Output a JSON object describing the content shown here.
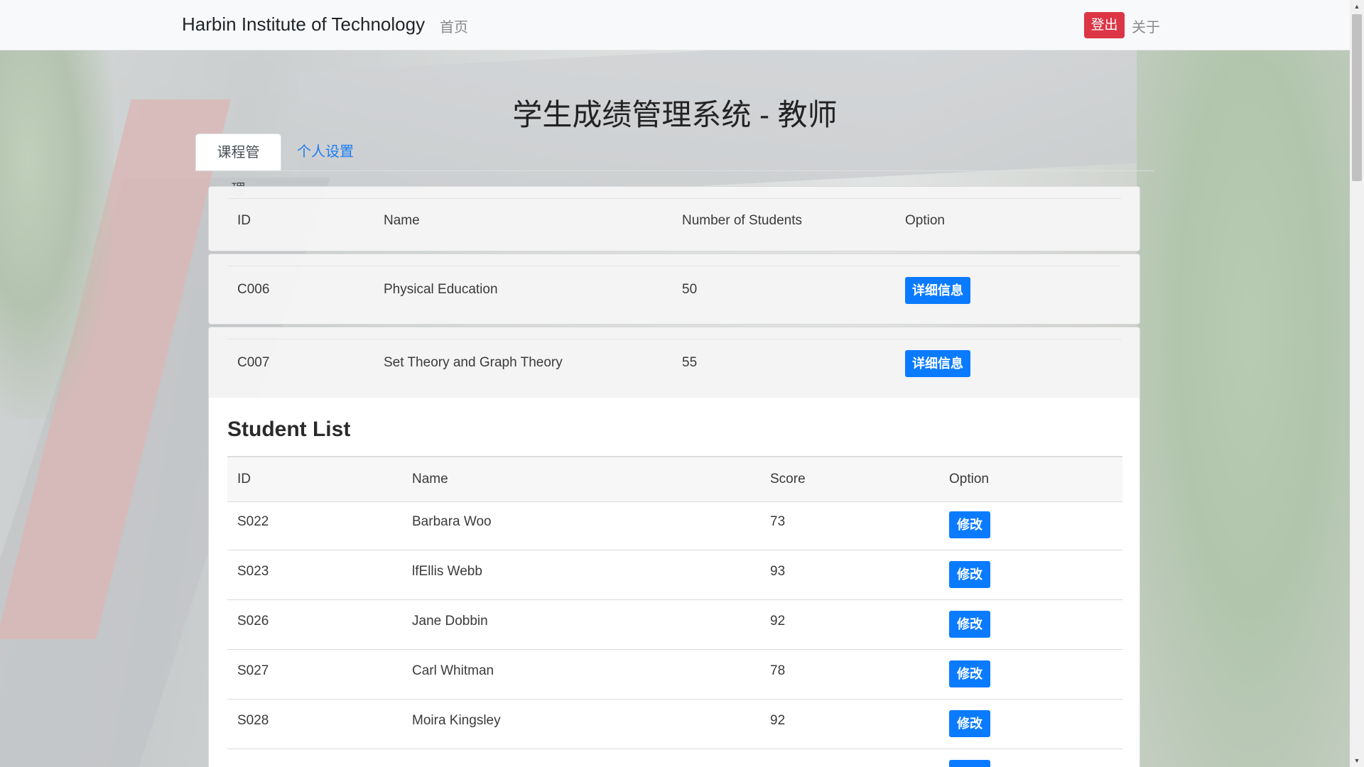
{
  "navbar": {
    "brand": "Harbin Institute of Technology",
    "home": "首页",
    "logout": "登出",
    "about": "关于"
  },
  "page_title": "学生成绩管理系统 - 教师",
  "tabs": [
    {
      "label": "课程管理",
      "active": true
    },
    {
      "label": "个人设置",
      "active": false
    }
  ],
  "courses": {
    "headers": [
      "ID",
      "Name",
      "Number of Students",
      "Option"
    ],
    "rows": [
      {
        "id": "C006",
        "name": "Physical Education",
        "students": "50",
        "action": "详细信息"
      },
      {
        "id": "C007",
        "name": "Set Theory and Graph Theory",
        "students": "55",
        "action": "详细信息"
      }
    ]
  },
  "student_list": {
    "title": "Student List",
    "headers": [
      "ID",
      "Name",
      "Score",
      "Option"
    ],
    "rows": [
      {
        "id": "S022",
        "name": "Barbara Woo",
        "score": "73",
        "action": "修改"
      },
      {
        "id": "S023",
        "name": "lfEllis Webb",
        "score": "93",
        "action": "修改"
      },
      {
        "id": "S026",
        "name": "Jane Dobbin",
        "score": "92",
        "action": "修改"
      },
      {
        "id": "S027",
        "name": "Carl Whitman",
        "score": "78",
        "action": "修改"
      },
      {
        "id": "S028",
        "name": "Moira Kingsley",
        "score": "92",
        "action": "修改"
      }
    ]
  },
  "colors": {
    "primary": "#0a7bff",
    "danger": "#dc3545",
    "link": "#1c7cf4"
  }
}
